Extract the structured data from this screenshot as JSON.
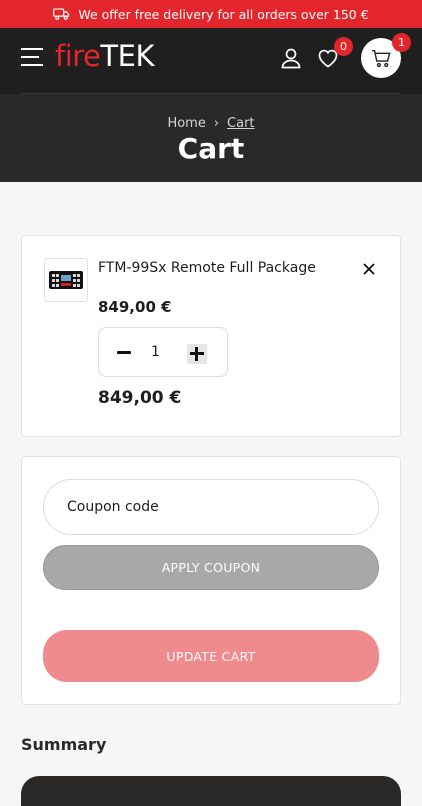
{
  "promo": {
    "text": "We offer free delivery for all orders over 150 €",
    "icon": "truck-icon"
  },
  "header": {
    "logo_part1": "fire",
    "logo_part2": "TEK",
    "wishlist_count": "0",
    "cart_count": "1",
    "icons": [
      "menu-icon",
      "user-icon",
      "heart-icon",
      "cart-icon"
    ]
  },
  "page": {
    "breadcrumb": {
      "home": "Home",
      "separator": "›",
      "current": "Cart"
    },
    "title": "Cart"
  },
  "cart_item": {
    "name": "FTM-99Sx Remote Full Package",
    "unit_price": "849,00 €",
    "quantity": "1",
    "subtotal": "849,00 €"
  },
  "coupon": {
    "placeholder": "Coupon code",
    "apply_label": "APPLY COUPON",
    "update_label": "UPDATE CART"
  },
  "summary": {
    "title": "Summary"
  },
  "colors": {
    "brand_red": "#e3262b",
    "dark": "#1f1f1f",
    "hero": "#2b2828",
    "apply_gray": "#a8a8a8",
    "update_pink": "#ef8a8d"
  }
}
